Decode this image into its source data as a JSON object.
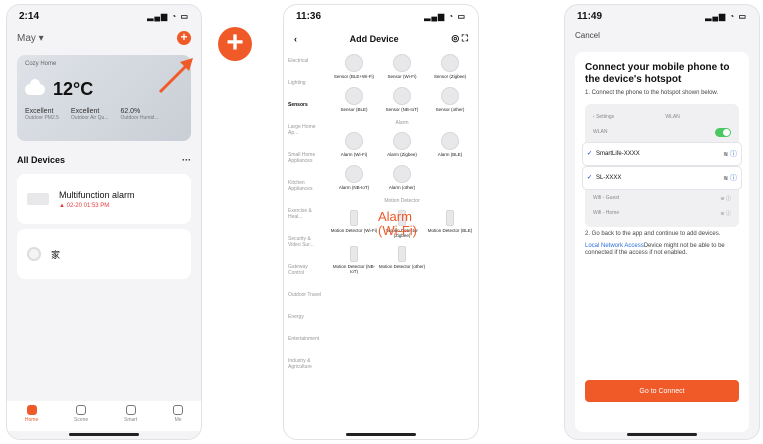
{
  "phone1": {
    "time": "2:14",
    "user": "May",
    "weather": {
      "home_label": "Cozy Home",
      "temperature": "12°C",
      "stats": [
        {
          "value": "Excellent",
          "label": "Outdoor PM2.5"
        },
        {
          "value": "Excellent",
          "label": "Outdoor Air Qu..."
        },
        {
          "value": "62.0%",
          "label": "Outdoor Humid..."
        }
      ]
    },
    "section_title": "All Devices",
    "section_more": "···",
    "devices": [
      {
        "name": "Multifunction alarm",
        "status": "02-20 01:53 PM"
      },
      {
        "name": "家",
        "status": ""
      }
    ],
    "tabs": [
      "Home",
      "Scene",
      "Smart",
      "Me"
    ]
  },
  "annotation_plus": "+",
  "phone2": {
    "time": "11:36",
    "title": "Add Device",
    "categories": [
      "Electrical",
      "Lighting",
      "Sensors",
      "Large Home Ap...",
      "Small Home Appliances",
      "Kitchen Appliances",
      "Exercise & Heal...",
      "Security & Video Sur...",
      "Gateway Control",
      "Outdoor Travel",
      "Energy",
      "Entertainment",
      "Industry & Agriculture"
    ],
    "sensor_items": [
      "Sensor (BLE+Wi-Fi)",
      "Sensor (Wi-Fi)",
      "Sensor (Zigbee)",
      "Sensor (BLE)",
      "Sensor (NB-IoT)",
      "Sensor (other)"
    ],
    "alarm_section": "Alarm",
    "alarm_items": [
      "Alarm (Wi-Fi)",
      "Alarm (Zigbee)",
      "Alarm (BLE)",
      "Alarm (NB-IoT)",
      "Alarm (other)"
    ],
    "motion_section": "Motion Detector",
    "motion_items": [
      "Motion Detector (Wi-Fi)",
      "Motion Detector (Zigbee)",
      "Motion Detector (BLE)",
      "Motion Detector (NB-IoT)",
      "Motion Detector (other)"
    ],
    "annotation_line1": "Alarm",
    "annotation_line2": "(Wi-Fi)"
  },
  "phone3": {
    "time": "11:49",
    "cancel": "Cancel",
    "title": "Connect your mobile phone to the device's hotspot",
    "step1": "1. Connect the phone to the hotspot shown below.",
    "settings_back": "Settings",
    "settings_title": "WLAN",
    "wlan_label": "WLAN",
    "networks_selected": [
      "SmartLife-XXXX",
      "SL-XXXX"
    ],
    "networks_other": [
      "Wifi - Guest",
      "Wifi - Home"
    ],
    "step2": "2. Go back to the app and continue to add devices.",
    "link_text": "Local Network Access",
    "note": "Device might not be able to be connected if the access if not enabled.",
    "button": "Go to Connect"
  }
}
